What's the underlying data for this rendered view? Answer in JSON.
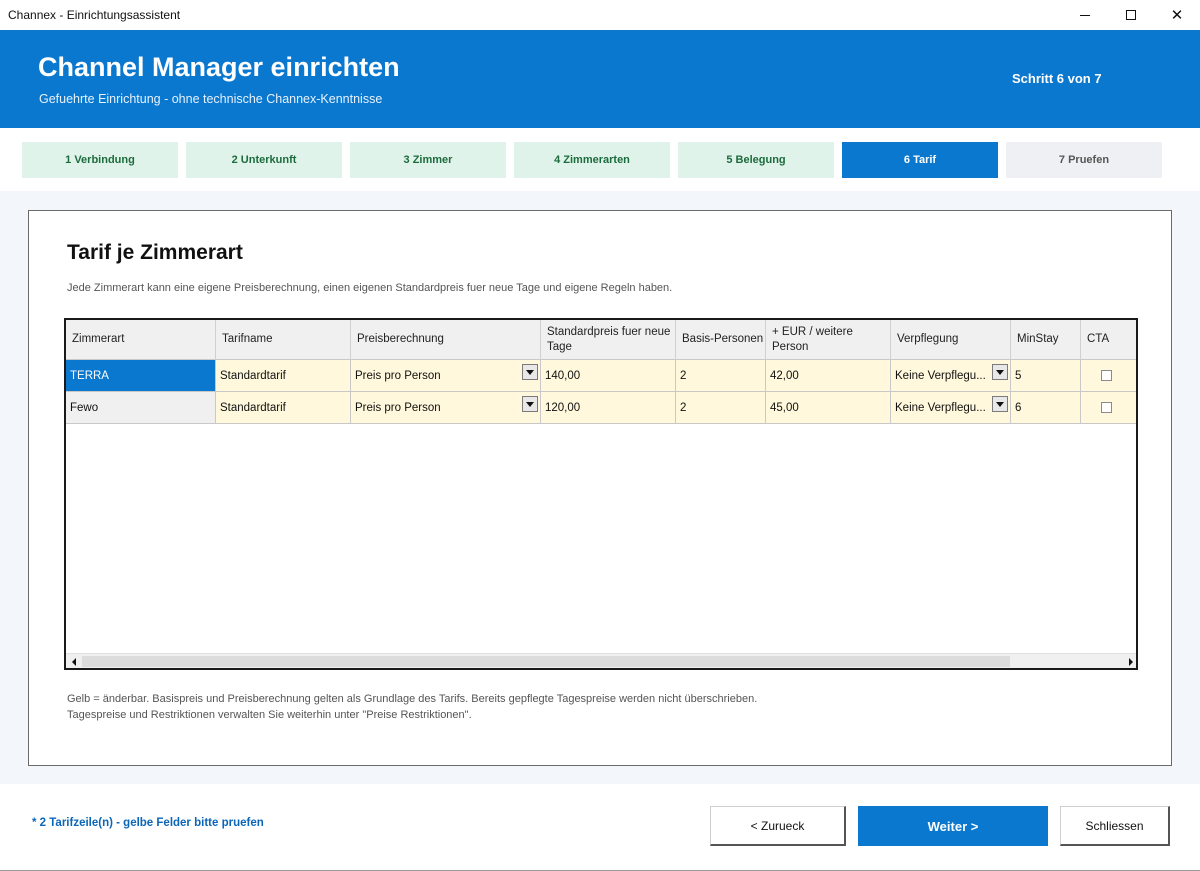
{
  "window": {
    "title": "Channex - Einrichtungsassistent"
  },
  "header": {
    "title": "Channel Manager einrichten",
    "subtitle": "Gefuehrte Einrichtung - ohne technische Channex-Kenntnisse",
    "step_indicator": "Schritt 6 von 7"
  },
  "steps": [
    {
      "label": "1  Verbindung",
      "state": "done"
    },
    {
      "label": "2  Unterkunft",
      "state": "done"
    },
    {
      "label": "3  Zimmer",
      "state": "done"
    },
    {
      "label": "4  Zimmerarten",
      "state": "done"
    },
    {
      "label": "5  Belegung",
      "state": "done"
    },
    {
      "label": "6  Tarif",
      "state": "active"
    },
    {
      "label": "7  Pruefen",
      "state": "todo"
    }
  ],
  "main": {
    "title": "Tarif je Zimmerart",
    "description": "Jede Zimmerart kann eine eigene Preisberechnung, einen eigenen Standardpreis fuer neue Tage und eigene Regeln haben.",
    "note_line1": "Gelb = änderbar. Basispreis und Preisberechnung gelten als Grundlage des Tarifs. Bereits gepflegte Tagespreise werden nicht überschrieben.",
    "note_line2": "Tagespreise und Restriktionen verwalten Sie weiterhin unter \"Preise  Restriktionen\"."
  },
  "grid": {
    "columns": [
      "Zimmerart",
      "Tarifname",
      "Preisberechnung",
      "Standardpreis fuer neue Tage",
      "Basis-Personen",
      "+ EUR / weitere Person",
      "Verpflegung",
      "MinStay",
      "CTA"
    ],
    "rows": [
      {
        "zimmerart": "TERRA",
        "tarifname": "Standardtarif",
        "preisberechnung": "Preis pro Person",
        "standardpreis": "140,00",
        "basis_personen": "2",
        "eur_weitere": "42,00",
        "verpflegung": "Keine Verpflegu...",
        "minstay": "5",
        "cta": false
      },
      {
        "zimmerart": "Fewo",
        "tarifname": "Standardtarif",
        "preisberechnung": "Preis pro Person",
        "standardpreis": "120,00",
        "basis_personen": "2",
        "eur_weitere": "45,00",
        "verpflegung": "Keine Verpflegu...",
        "minstay": "6",
        "cta": false
      }
    ]
  },
  "footer": {
    "status": "* 2 Tarifzeile(n) - gelbe Felder bitte pruefen",
    "back_label": "<  Zurueck",
    "next_label": "Weiter  >",
    "close_label": "Schliessen"
  },
  "colors": {
    "accent": "#0b78d0",
    "editable_cell": "#fff8dc",
    "step_done": "#e0f3ea",
    "step_todo": "#eef0f3"
  },
  "icons": [
    "minimize-icon",
    "maximize-icon",
    "close-icon",
    "dropdown-arrow-icon",
    "scroll-left-icon",
    "scroll-right-icon"
  ]
}
